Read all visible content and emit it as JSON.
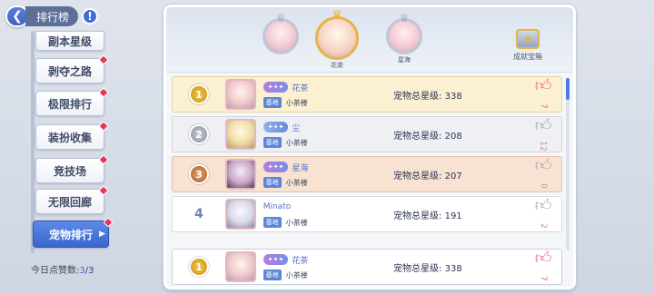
{
  "header": {
    "back_glyph": "❮",
    "title": "排行榜",
    "info_glyph": "!"
  },
  "sidebar": {
    "items": [
      {
        "label": "副本星级",
        "dot": true
      },
      {
        "label": "剥夺之路",
        "dot": true
      },
      {
        "label": "极限排行",
        "dot": true
      },
      {
        "label": "装扮收集",
        "dot": true
      },
      {
        "label": "竞技场",
        "dot": true
      },
      {
        "label": "无限回廊",
        "dot": true
      },
      {
        "label": "宠物排行",
        "dot": true,
        "active": true
      }
    ],
    "likes_label": "今日点赞数:",
    "likes_value": "3",
    "likes_total": "/3"
  },
  "podium": {
    "second": {
      "name": ""
    },
    "first": {
      "name": "花茶"
    },
    "third": {
      "name": "星海"
    },
    "chest_label": "成就宝箱"
  },
  "rows": [
    {
      "rank": "1",
      "medal": "gold",
      "title_badge": "",
      "name": "花茶",
      "guild_tag": "基地",
      "guild": "小茶楼",
      "stars_label": "宠物总星级:",
      "stars": "338",
      "likes": "7",
      "liked": true
    },
    {
      "rank": "2",
      "medal": "silver",
      "title_badge": "",
      "name": "尘",
      "guild_tag": "基地",
      "guild": "小茶楼",
      "stars_label": "宠物总星级:",
      "stars": "208",
      "likes": "12",
      "liked": false
    },
    {
      "rank": "3",
      "medal": "bronze",
      "title_badge": "",
      "name": "星海",
      "guild_tag": "基地",
      "guild": "小茶楼",
      "stars_label": "宠物总星级:",
      "stars": "207",
      "likes": "0",
      "liked": false
    },
    {
      "rank": "4",
      "medal": "none",
      "title_badge": "",
      "name": "Minato",
      "guild_tag": "基地",
      "guild": "小茶楼",
      "stars_label": "宠物总星级:",
      "stars": "191",
      "likes": "2",
      "liked": false
    }
  ],
  "my_row": {
    "rank": "1",
    "name": "花茶",
    "guild_tag": "基地",
    "guild": "小茶楼",
    "stars_label": "宠物总星级:",
    "stars": "338",
    "likes": "7"
  },
  "colors": {
    "accent": "#3f6fd6",
    "like": "#e86a88",
    "gold_row": "#fbf0d2",
    "bronze_row": "#f8e3d3"
  }
}
